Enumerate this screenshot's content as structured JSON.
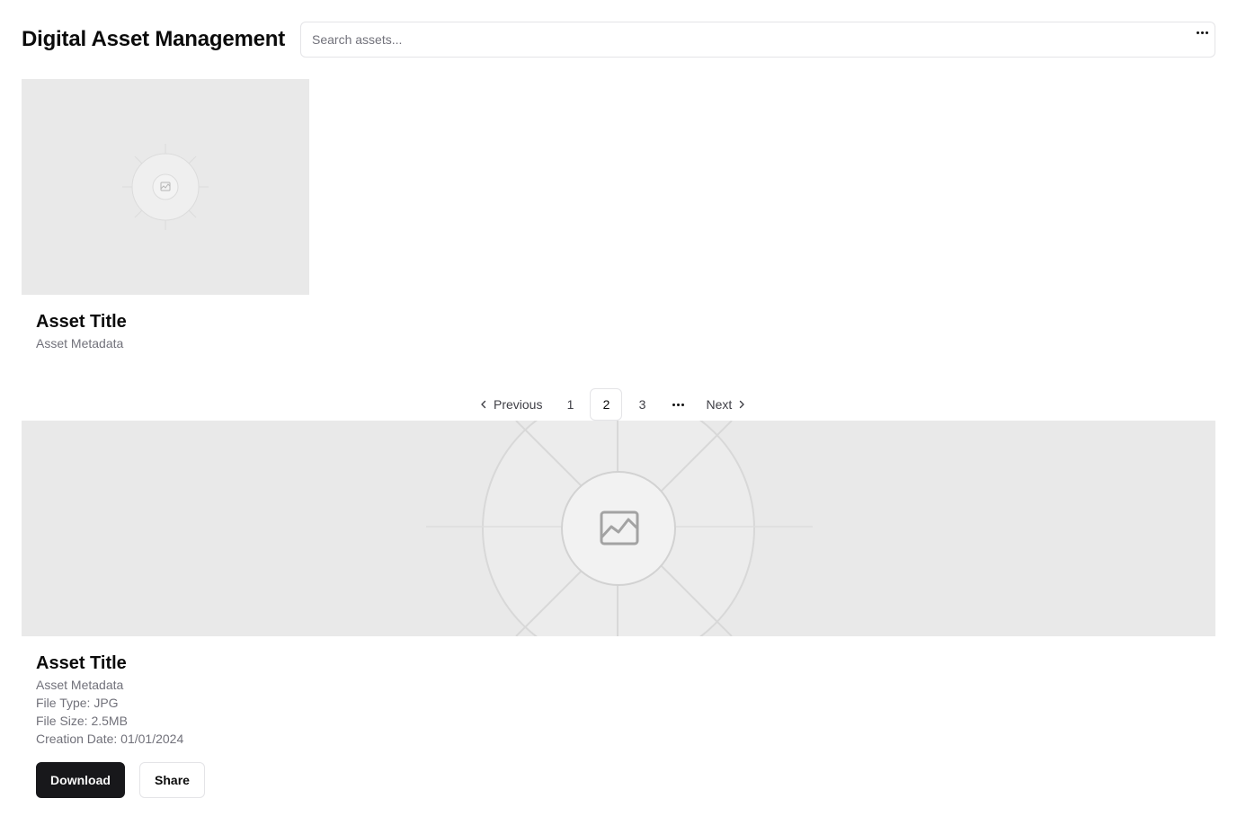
{
  "header": {
    "title": "Digital Asset Management",
    "search_placeholder": "Search assets...",
    "more_icon": "more-horizontal-icon"
  },
  "first_asset": {
    "title": "Asset Title",
    "metadata": "Asset Metadata",
    "image_icon": "image-placeholder-icon"
  },
  "pagination": {
    "previous_label": "Previous",
    "next_label": "Next",
    "pages": [
      "1",
      "2",
      "3"
    ],
    "current_page": "2",
    "ellipsis_icon": "more-horizontal-icon"
  },
  "selected_asset": {
    "title": "Asset Title",
    "metadata": "Asset Metadata",
    "file_type": "File Type: JPG",
    "file_size": "File Size: 2.5MB",
    "creation_date": "Creation Date: 01/01/2024",
    "download_label": "Download",
    "share_label": "Share",
    "image_icon": "image-placeholder-icon"
  },
  "colors": {
    "primary_button": "#18181b",
    "muted_text": "#71717a",
    "placeholder_bg": "#e9e9e9",
    "border": "#e4e4e7"
  }
}
